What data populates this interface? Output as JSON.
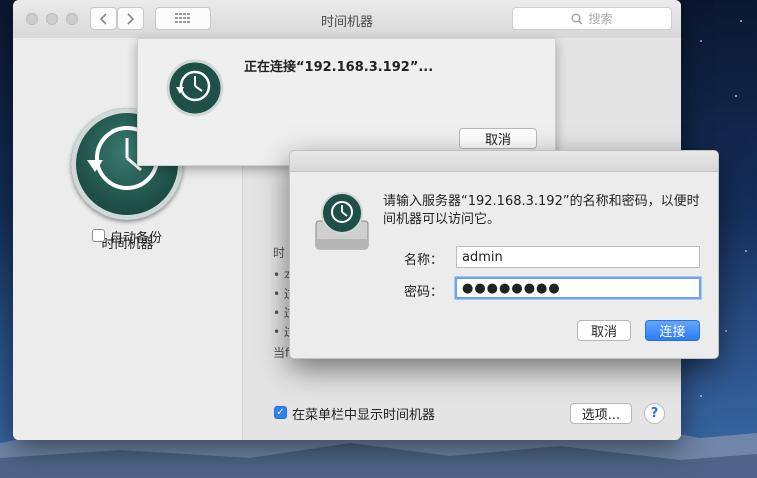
{
  "window": {
    "title": "时间机器",
    "search_placeholder": "搜索"
  },
  "left_pane": {
    "app_label": "时间机器",
    "auto_backup_label": "自动备份",
    "auto_backup_checked": false
  },
  "right_pane": {
    "partial_heading": "时",
    "partial_bullets": [
      "• 本",
      "• 过",
      "• 过",
      "• 过"
    ],
    "partial_footer": "当f",
    "menubar_checkbox_label": "在菜单栏中显示时间机器",
    "menubar_checked": true,
    "options_button": "选项...",
    "help_button": "?"
  },
  "connect_sheet": {
    "status_text": "正在连接“192.168.3.192”...",
    "cancel_button": "取消"
  },
  "login_dialog": {
    "message": "请输入服务器“192.168.3.192”的名称和密码，以便时间机器可以访问它。",
    "name_label": "名称：",
    "name_value": "admin",
    "password_label": "密码：",
    "password_value": "●●●●●●●●",
    "cancel_button": "取消",
    "connect_button": "连接"
  },
  "icons": [
    "time-machine-icon",
    "search-icon",
    "back-chevron-icon",
    "forward-chevron-icon",
    "grid-icon"
  ]
}
